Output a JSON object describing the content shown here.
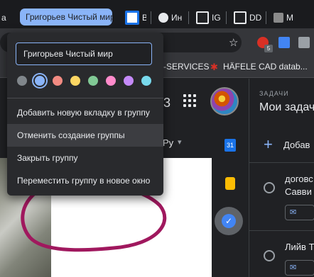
{
  "tabs": {
    "group_chip_label": "Григорьев Чистый мир",
    "items": [
      {
        "label": "Вс",
        "fav_color": "#1a73e8"
      },
      {
        "label": "Ин",
        "fav_color": "#e8eaed"
      },
      {
        "label": "IG",
        "fav_color": "#e8eaed"
      },
      {
        "label": "DD",
        "fav_color": "#e8eaed"
      },
      {
        "label": "M",
        "fav_color": "#8a8a8a"
      }
    ]
  },
  "toolbar": {
    "star_icon": "star-icon",
    "extension_badge": "5"
  },
  "bookmarks": {
    "items": [
      "-SERVICES",
      "HÄFELE CAD datab..."
    ]
  },
  "group_menu": {
    "name_value": "Григорьев Чистый мир",
    "colors": [
      "#80868b",
      "#8ab4f8",
      "#f28b82",
      "#fdd663",
      "#81c995",
      "#ff8bcb",
      "#c58af9",
      "#78d9ec"
    ],
    "selected_color_index": 1,
    "items": [
      "Добавить новую вкладку в группу",
      "Отменить создание группы",
      "Закрыть группу",
      "Переместить группу в новое окно"
    ],
    "hovered_index": 1
  },
  "page": {
    "filter_label": "Ру",
    "tasks": {
      "header": "ЗАДАЧИ",
      "title": "Мои задач",
      "add_label": "Добав",
      "entries": [
        {
          "line1": "договс",
          "line2": "Савви"
        },
        {
          "line1": "Лийв Т",
          "line2": ""
        }
      ]
    }
  }
}
